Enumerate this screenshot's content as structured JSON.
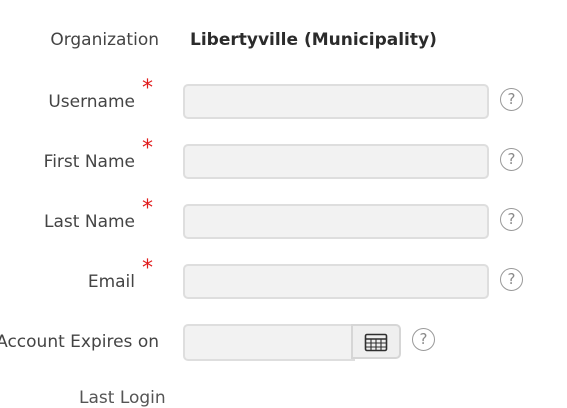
{
  "form": {
    "organization": {
      "label": "Organization",
      "value": "Libertyville (Municipality)"
    },
    "username": {
      "label": "Username",
      "required_mark": "*",
      "value": "",
      "help_icon": "question-circle-icon"
    },
    "first_name": {
      "label": "First Name",
      "required_mark": "*",
      "value": "",
      "help_icon": "question-circle-icon"
    },
    "last_name": {
      "label": "Last Name",
      "required_mark": "*",
      "value": "",
      "help_icon": "question-circle-icon"
    },
    "email": {
      "label": "Email",
      "required_mark": "*",
      "value": "",
      "help_icon": "question-circle-icon"
    },
    "account_expires": {
      "label": "Account Expires on",
      "value": "",
      "calendar_icon": "calendar-icon",
      "help_icon": "question-circle-icon"
    },
    "last_login": {
      "label": "Last Login"
    }
  },
  "help_glyph": "?",
  "colors": {
    "required": "#e01b1b",
    "input_bg": "#f2f2f2",
    "input_border": "#dedede",
    "help_icon": "#9a9a9a"
  }
}
